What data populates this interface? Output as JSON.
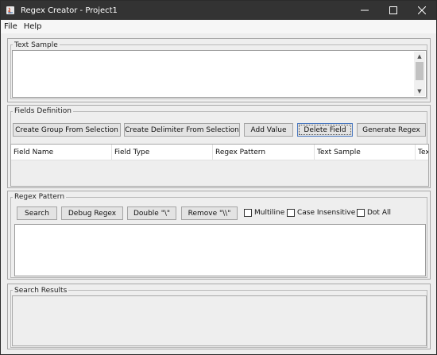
{
  "window": {
    "title": "Regex Creator - Project1"
  },
  "menu": {
    "items": [
      "File",
      "Help"
    ]
  },
  "text_sample": {
    "legend": "Text Sample",
    "value": ""
  },
  "fields_definition": {
    "legend": "Fields Definition",
    "buttons": {
      "create_group": "Create Group From Selection",
      "create_delimiter": "Create Delimiter From Selection",
      "add_value": "Add Value",
      "delete_field": "Delete Field",
      "generate_regex": "Generate Regex"
    },
    "columns": [
      "Field Name",
      "Field Type",
      "Regex Pattern",
      "Text Sample",
      "Tex"
    ],
    "rows": []
  },
  "regex_pattern": {
    "legend": "Regex Pattern",
    "buttons": {
      "search": "Search",
      "debug_regex": "Debug Regex",
      "double": "Double \"\\\"",
      "remove": "Remove \"\\\\\""
    },
    "options": {
      "multiline": {
        "label": "Multiline",
        "checked": false
      },
      "case_insensitive": {
        "label": "Case Insensitive",
        "checked": false
      },
      "dot_all": {
        "label": "Dot All",
        "checked": false
      }
    },
    "value": ""
  },
  "search_results": {
    "legend": "Search Results"
  }
}
